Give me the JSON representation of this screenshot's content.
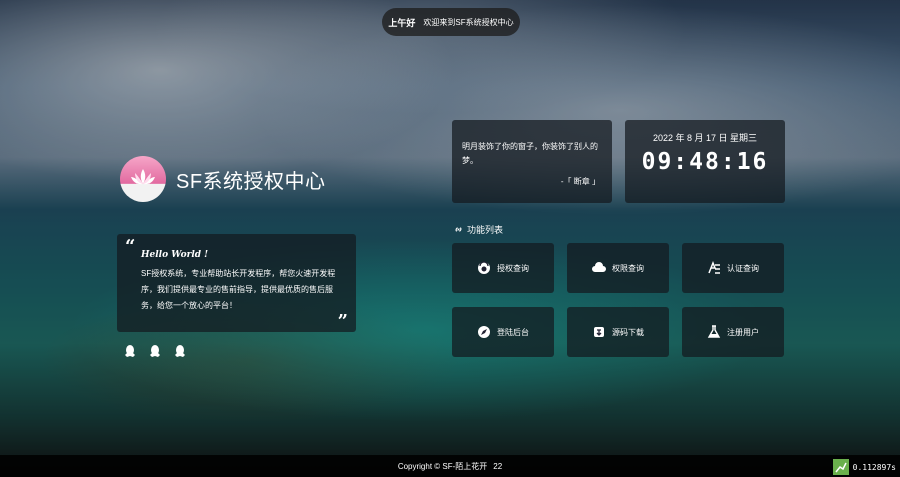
{
  "greeting": {
    "hello": "上午好",
    "welcome": "欢迎来到SF系统授权中心"
  },
  "brand": {
    "name": "SF系统授权中心",
    "logo_icon": "lotus-icon",
    "accent": "#e26aa0"
  },
  "intro": {
    "hello": "Hello World !",
    "text": "SF授权系统，专业帮助站长开发程序，帮您火速开发程序，我们提供最专业的售前指导，提供最优质的售后服务，给您一个放心的平台！"
  },
  "social": [
    "qq-icon",
    "qq-icon",
    "qq-icon"
  ],
  "poem": {
    "text": "明月装饰了你的窗子，你装饰了别人的梦。",
    "author": "-「 断章 」"
  },
  "clock": {
    "date": "2022 年 8 月 17 日 星期三",
    "time": "09:48:16"
  },
  "functions": {
    "title": "功能列表",
    "items": [
      {
        "label": "授权查询",
        "icon": "auth-query-icon"
      },
      {
        "label": "权限查询",
        "icon": "cloud-icon"
      },
      {
        "label": "认证查询",
        "icon": "verify-icon"
      },
      {
        "label": "登陆后台",
        "icon": "compass-icon"
      },
      {
        "label": "源码下载",
        "icon": "download-icon"
      },
      {
        "label": "注册用户",
        "icon": "flask-icon"
      }
    ]
  },
  "footer": {
    "copyright": "Copyright © SF-陌上花开",
    "year": "22"
  },
  "perf": {
    "time": "0.112897s"
  }
}
